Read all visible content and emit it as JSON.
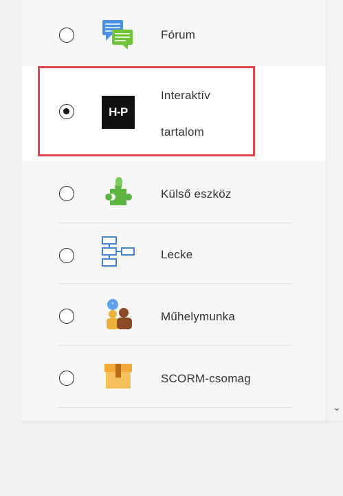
{
  "activities": [
    {
      "label": "Fórum",
      "icon": "forum-icon",
      "selected": false
    },
    {
      "label_line1": "Interaktív",
      "label_line2": "tartalom",
      "icon": "h5p-icon",
      "icon_text": "H-P",
      "selected": true
    },
    {
      "label": "Külső eszköz",
      "icon": "puzzle-icon",
      "selected": false
    },
    {
      "label": "Lecke",
      "icon": "lesson-icon",
      "selected": false
    },
    {
      "label": "Műhelymunka",
      "icon": "workshop-icon",
      "selected": false
    },
    {
      "label": "SCORM-csomag",
      "icon": "scorm-package-icon",
      "selected": false
    }
  ],
  "colors": {
    "highlight_border": "#e0464b",
    "panel_bg": "#f7f7f7"
  }
}
